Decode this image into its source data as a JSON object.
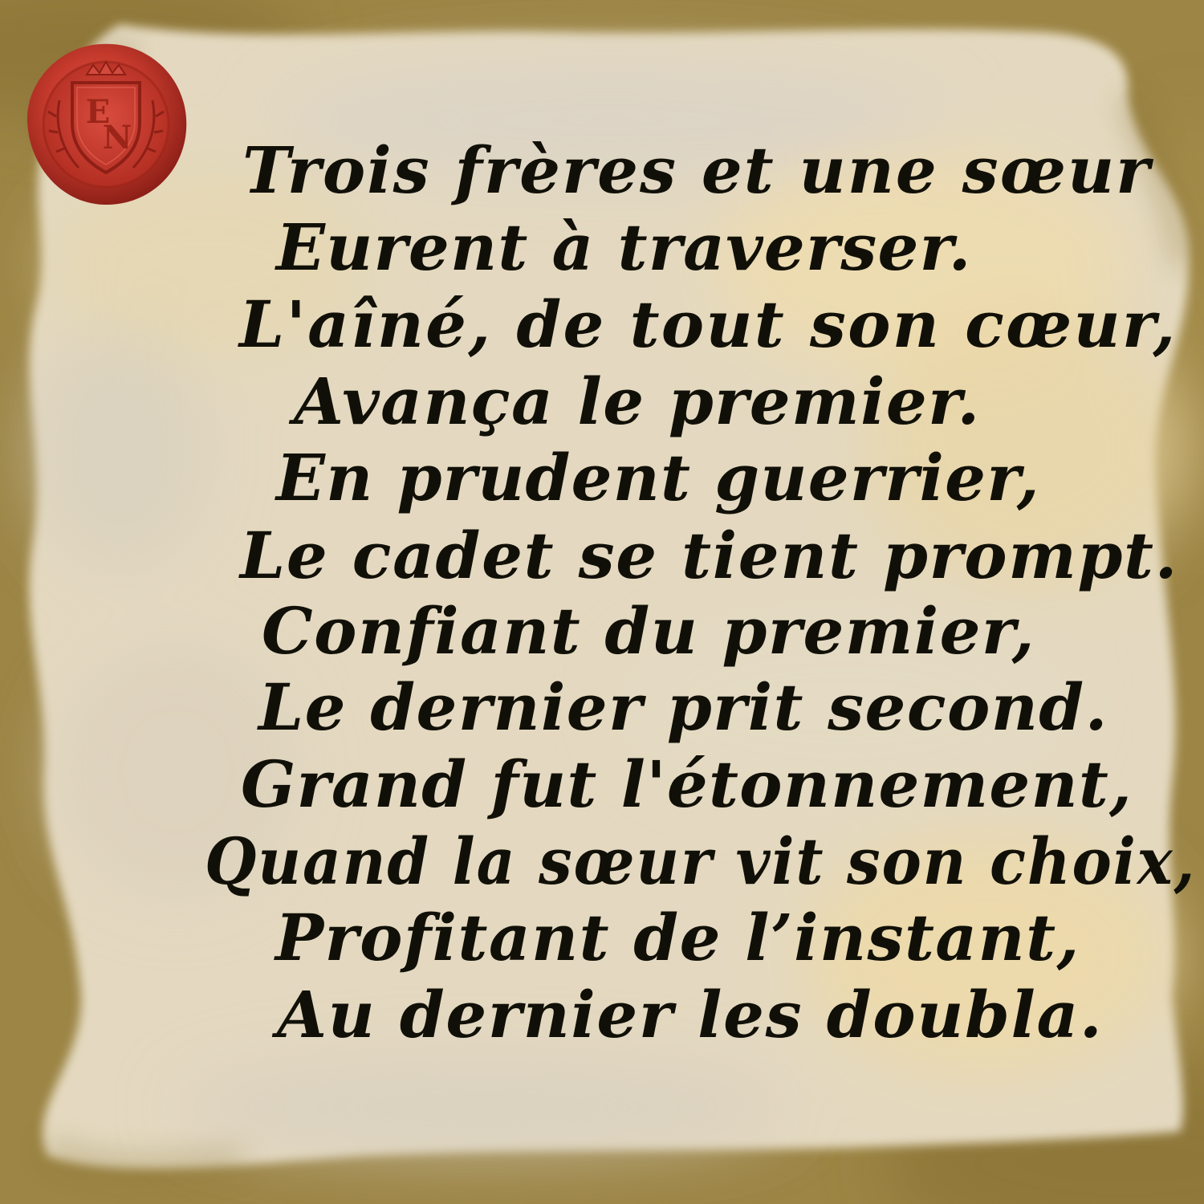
{
  "seal": {
    "monogram": "EN",
    "color": "#c8382a"
  },
  "poem": {
    "lines": [
      "Trois frères et une sœur",
      "Eurent à traverser.",
      "L'aîné, de tout son cœur,",
      "Avança le premier.",
      "En prudent guerrier,",
      "Le cadet se tient prompt.",
      "Confiant du premier,",
      "Le dernier prit second.",
      "Grand fut l'étonnement,",
      "Quand la sœur vit son choix,",
      "Profitant de l’instant,",
      "Au dernier les doubla."
    ]
  },
  "colors": {
    "frame": "#9c8545",
    "parchment": "#e6dcc4",
    "ink": "#111008"
  }
}
